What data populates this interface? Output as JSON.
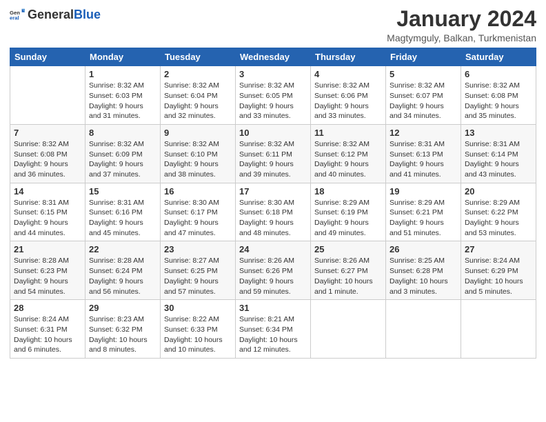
{
  "header": {
    "logo_general": "General",
    "logo_blue": "Blue",
    "main_title": "January 2024",
    "sub_title": "Magtymguly, Balkan, Turkmenistan"
  },
  "days_of_week": [
    "Sunday",
    "Monday",
    "Tuesday",
    "Wednesday",
    "Thursday",
    "Friday",
    "Saturday"
  ],
  "weeks": [
    [
      {
        "day": "",
        "sunrise": "",
        "sunset": "",
        "daylight": ""
      },
      {
        "day": "1",
        "sunrise": "Sunrise: 8:32 AM",
        "sunset": "Sunset: 6:03 PM",
        "daylight": "Daylight: 9 hours and 31 minutes."
      },
      {
        "day": "2",
        "sunrise": "Sunrise: 8:32 AM",
        "sunset": "Sunset: 6:04 PM",
        "daylight": "Daylight: 9 hours and 32 minutes."
      },
      {
        "day": "3",
        "sunrise": "Sunrise: 8:32 AM",
        "sunset": "Sunset: 6:05 PM",
        "daylight": "Daylight: 9 hours and 33 minutes."
      },
      {
        "day": "4",
        "sunrise": "Sunrise: 8:32 AM",
        "sunset": "Sunset: 6:06 PM",
        "daylight": "Daylight: 9 hours and 33 minutes."
      },
      {
        "day": "5",
        "sunrise": "Sunrise: 8:32 AM",
        "sunset": "Sunset: 6:07 PM",
        "daylight": "Daylight: 9 hours and 34 minutes."
      },
      {
        "day": "6",
        "sunrise": "Sunrise: 8:32 AM",
        "sunset": "Sunset: 6:08 PM",
        "daylight": "Daylight: 9 hours and 35 minutes."
      }
    ],
    [
      {
        "day": "7",
        "sunrise": "Sunrise: 8:32 AM",
        "sunset": "Sunset: 6:08 PM",
        "daylight": "Daylight: 9 hours and 36 minutes."
      },
      {
        "day": "8",
        "sunrise": "Sunrise: 8:32 AM",
        "sunset": "Sunset: 6:09 PM",
        "daylight": "Daylight: 9 hours and 37 minutes."
      },
      {
        "day": "9",
        "sunrise": "Sunrise: 8:32 AM",
        "sunset": "Sunset: 6:10 PM",
        "daylight": "Daylight: 9 hours and 38 minutes."
      },
      {
        "day": "10",
        "sunrise": "Sunrise: 8:32 AM",
        "sunset": "Sunset: 6:11 PM",
        "daylight": "Daylight: 9 hours and 39 minutes."
      },
      {
        "day": "11",
        "sunrise": "Sunrise: 8:32 AM",
        "sunset": "Sunset: 6:12 PM",
        "daylight": "Daylight: 9 hours and 40 minutes."
      },
      {
        "day": "12",
        "sunrise": "Sunrise: 8:31 AM",
        "sunset": "Sunset: 6:13 PM",
        "daylight": "Daylight: 9 hours and 41 minutes."
      },
      {
        "day": "13",
        "sunrise": "Sunrise: 8:31 AM",
        "sunset": "Sunset: 6:14 PM",
        "daylight": "Daylight: 9 hours and 43 minutes."
      }
    ],
    [
      {
        "day": "14",
        "sunrise": "Sunrise: 8:31 AM",
        "sunset": "Sunset: 6:15 PM",
        "daylight": "Daylight: 9 hours and 44 minutes."
      },
      {
        "day": "15",
        "sunrise": "Sunrise: 8:31 AM",
        "sunset": "Sunset: 6:16 PM",
        "daylight": "Daylight: 9 hours and 45 minutes."
      },
      {
        "day": "16",
        "sunrise": "Sunrise: 8:30 AM",
        "sunset": "Sunset: 6:17 PM",
        "daylight": "Daylight: 9 hours and 47 minutes."
      },
      {
        "day": "17",
        "sunrise": "Sunrise: 8:30 AM",
        "sunset": "Sunset: 6:18 PM",
        "daylight": "Daylight: 9 hours and 48 minutes."
      },
      {
        "day": "18",
        "sunrise": "Sunrise: 8:29 AM",
        "sunset": "Sunset: 6:19 PM",
        "daylight": "Daylight: 9 hours and 49 minutes."
      },
      {
        "day": "19",
        "sunrise": "Sunrise: 8:29 AM",
        "sunset": "Sunset: 6:21 PM",
        "daylight": "Daylight: 9 hours and 51 minutes."
      },
      {
        "day": "20",
        "sunrise": "Sunrise: 8:29 AM",
        "sunset": "Sunset: 6:22 PM",
        "daylight": "Daylight: 9 hours and 53 minutes."
      }
    ],
    [
      {
        "day": "21",
        "sunrise": "Sunrise: 8:28 AM",
        "sunset": "Sunset: 6:23 PM",
        "daylight": "Daylight: 9 hours and 54 minutes."
      },
      {
        "day": "22",
        "sunrise": "Sunrise: 8:28 AM",
        "sunset": "Sunset: 6:24 PM",
        "daylight": "Daylight: 9 hours and 56 minutes."
      },
      {
        "day": "23",
        "sunrise": "Sunrise: 8:27 AM",
        "sunset": "Sunset: 6:25 PM",
        "daylight": "Daylight: 9 hours and 57 minutes."
      },
      {
        "day": "24",
        "sunrise": "Sunrise: 8:26 AM",
        "sunset": "Sunset: 6:26 PM",
        "daylight": "Daylight: 9 hours and 59 minutes."
      },
      {
        "day": "25",
        "sunrise": "Sunrise: 8:26 AM",
        "sunset": "Sunset: 6:27 PM",
        "daylight": "Daylight: 10 hours and 1 minute."
      },
      {
        "day": "26",
        "sunrise": "Sunrise: 8:25 AM",
        "sunset": "Sunset: 6:28 PM",
        "daylight": "Daylight: 10 hours and 3 minutes."
      },
      {
        "day": "27",
        "sunrise": "Sunrise: 8:24 AM",
        "sunset": "Sunset: 6:29 PM",
        "daylight": "Daylight: 10 hours and 5 minutes."
      }
    ],
    [
      {
        "day": "28",
        "sunrise": "Sunrise: 8:24 AM",
        "sunset": "Sunset: 6:31 PM",
        "daylight": "Daylight: 10 hours and 6 minutes."
      },
      {
        "day": "29",
        "sunrise": "Sunrise: 8:23 AM",
        "sunset": "Sunset: 6:32 PM",
        "daylight": "Daylight: 10 hours and 8 minutes."
      },
      {
        "day": "30",
        "sunrise": "Sunrise: 8:22 AM",
        "sunset": "Sunset: 6:33 PM",
        "daylight": "Daylight: 10 hours and 10 minutes."
      },
      {
        "day": "31",
        "sunrise": "Sunrise: 8:21 AM",
        "sunset": "Sunset: 6:34 PM",
        "daylight": "Daylight: 10 hours and 12 minutes."
      },
      {
        "day": "",
        "sunrise": "",
        "sunset": "",
        "daylight": ""
      },
      {
        "day": "",
        "sunrise": "",
        "sunset": "",
        "daylight": ""
      },
      {
        "day": "",
        "sunrise": "",
        "sunset": "",
        "daylight": ""
      }
    ]
  ]
}
